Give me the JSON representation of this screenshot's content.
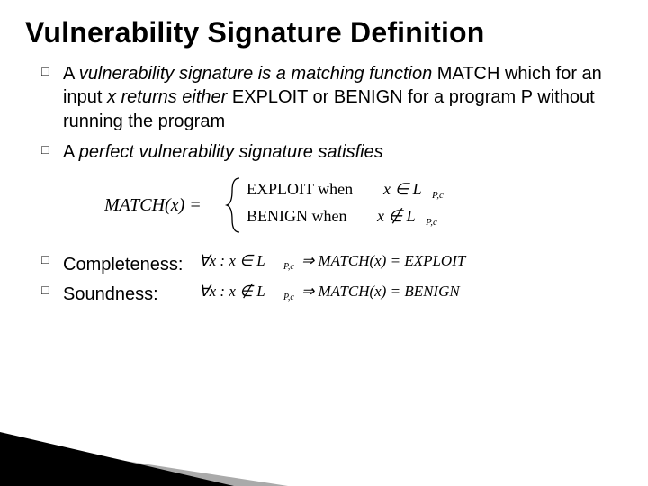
{
  "title": "Vulnerability Signature Definition",
  "bullets": {
    "a_pre": "A ",
    "a_it1": "vulnerability signature is a matching function ",
    "a_mid1": "MATCH which for an input ",
    "a_x": "x",
    "a_mid2": " returns either ",
    "a_mid3": "EXPLOIT or BENIGN for a program P without running the program",
    "b_pre": "A ",
    "b_it": "perfect vulnerability signature satisfies"
  },
  "math": {
    "match_lhs": "MATCH(x) =",
    "case1_text": "EXPLOIT when",
    "case1_rel": "x ∈ L",
    "case1_sub": "P,c",
    "case2_text": "BENIGN when",
    "case2_rel": "x ∉ L",
    "case2_sub": "P,c"
  },
  "lower": {
    "completeness_label": "Completeness:",
    "soundness_label": "Soundness:",
    "c_forall": "∀x : x ∈ L",
    "c_sub": "P,c",
    "c_arrow": " ⇒ MATCH(x) = EXPLOIT",
    "s_forall": "∀x : x ∉ L",
    "s_sub": "P,c",
    "s_arrow": " ⇒ MATCH(x) = BENIGN"
  }
}
